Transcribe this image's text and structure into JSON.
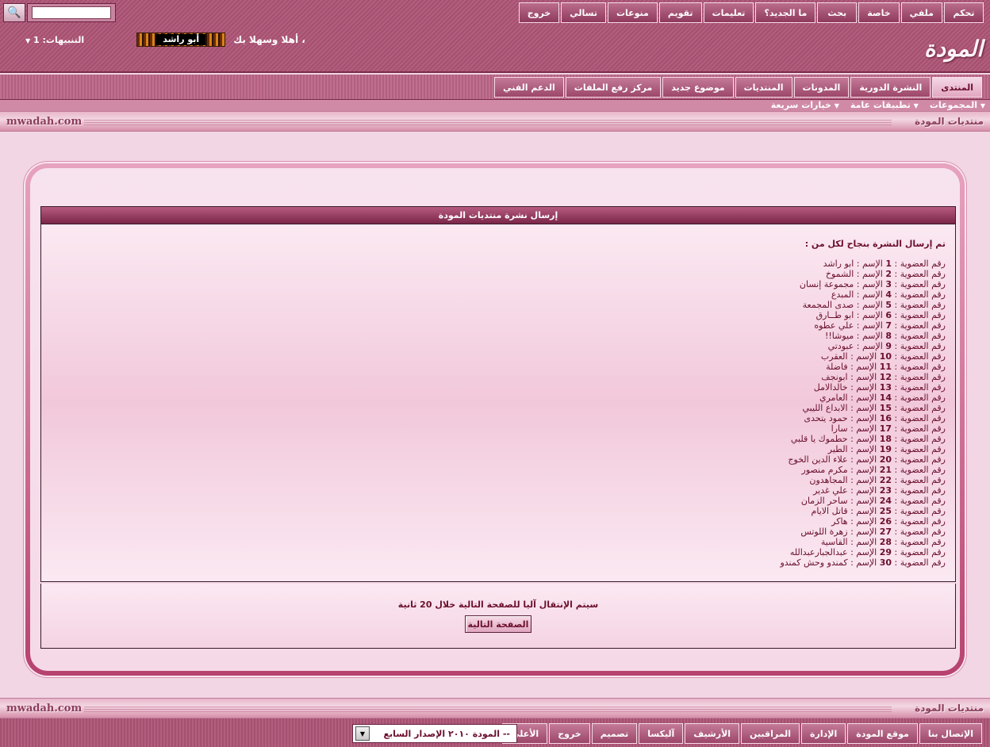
{
  "header": {
    "logo_text": "المودة",
    "top_menu": [
      "تحكم",
      "ملفي",
      "خاصة",
      "بحث",
      "ما الجديد؟",
      "تعليمات",
      "تقويم",
      "منوعات",
      "تسالي",
      "خروج"
    ],
    "welcome_text": "أهلا وسهلا بك ،",
    "username": "أبو راشد",
    "alerts_label": "التنبيهات: 1"
  },
  "navbar": {
    "tabs": [
      "المنتدى",
      "النشرة الدورية",
      "المدونات",
      "المنتديات",
      "موضوع جديد",
      "مركز رفع الملفات",
      "الدعم الفني"
    ],
    "active_tab": "المنتدى",
    "sub_items": [
      "المجموعات",
      "تطبيقات عامة",
      "خيارات سريعة"
    ]
  },
  "sitebar": {
    "left": "mwadah.com",
    "right": "منتديات المودة"
  },
  "panel": {
    "title": "إرسال نشرة منتديات المودة",
    "intro": "تم إرسال النشرة بنجاح لكل من :",
    "members": [
      {
        "id": "1",
        "name": "ابو راشد"
      },
      {
        "id": "2",
        "name": "الشموخ"
      },
      {
        "id": "3",
        "name": "مجموعة إنسان"
      },
      {
        "id": "4",
        "name": "المبدع"
      },
      {
        "id": "5",
        "name": "صدى المجمعة"
      },
      {
        "id": "6",
        "name": "ابو طــارق"
      },
      {
        "id": "7",
        "name": "علي عطوه"
      },
      {
        "id": "8",
        "name": "ميوشا!!"
      },
      {
        "id": "9",
        "name": "عبودتي"
      },
      {
        "id": "10",
        "name": "العقرب"
      },
      {
        "id": "11",
        "name": "فاضلة"
      },
      {
        "id": "12",
        "name": "ابونجف"
      },
      {
        "id": "13",
        "name": "خالدالامل"
      },
      {
        "id": "14",
        "name": "العامري"
      },
      {
        "id": "15",
        "name": "الابداع الليبي"
      },
      {
        "id": "16",
        "name": "حمود يتحدى"
      },
      {
        "id": "17",
        "name": "سارا"
      },
      {
        "id": "18",
        "name": "حطموك يا قلبي"
      },
      {
        "id": "19",
        "name": "الطير"
      },
      {
        "id": "20",
        "name": "علاء الدين الخوج"
      },
      {
        "id": "21",
        "name": "مكرم منصور"
      },
      {
        "id": "22",
        "name": "المجاهدون"
      },
      {
        "id": "23",
        "name": "علي غدير"
      },
      {
        "id": "24",
        "name": "ساحر الزمان"
      },
      {
        "id": "25",
        "name": "قاتل الايام"
      },
      {
        "id": "26",
        "name": "هاكر"
      },
      {
        "id": "27",
        "name": "زهرة اللوتس"
      },
      {
        "id": "28",
        "name": "القاسية"
      },
      {
        "id": "29",
        "name": "عبدالجبارعبدالله"
      },
      {
        "id": "30",
        "name": "كمندو وحش كمندو"
      }
    ],
    "row_label_id": "رقم العضوية :",
    "row_label_name": "الإسم :",
    "redirect_text": "سيتم الإنتقال آليا للصفحة التالية خلال 20 ثانية",
    "next_button": "الصفحة التالية"
  },
  "footer": {
    "links": [
      "الإتصال بنا",
      "موقع المودة",
      "الإدارة",
      "المراقبين",
      "الأرشيف",
      "آليكسا",
      "تصميم",
      "خروج",
      "الأعلى"
    ],
    "style_select_value": "-- المودة ٢٠١٠ الإصدار السابع"
  },
  "colors": {
    "accent": "#8f3a5d",
    "page_bg": "#f2d6e4",
    "text": "#6b0f2c"
  },
  "icons": {
    "search": "search-icon",
    "dropdown": "caret-down-icon"
  }
}
